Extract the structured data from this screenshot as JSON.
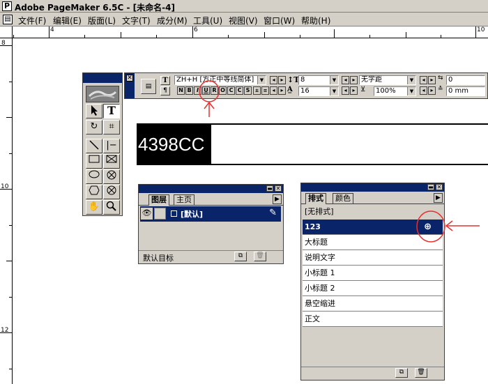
{
  "window": {
    "title": "Adobe PageMaker 6.5C - [未命名-4]"
  },
  "menubar": {
    "items": [
      "文件(F)",
      "编辑(E)",
      "版面(L)",
      "文字(T)",
      "成分(M)",
      "工具(U)",
      "视图(V)",
      "窗口(W)",
      "帮助(H)"
    ]
  },
  "ruler": {
    "top_labels": [
      "4",
      "6",
      "10"
    ],
    "left_labels": [
      "8",
      "10",
      "12"
    ]
  },
  "control_palette": {
    "font": "ZH+H  [方正中等线简体]",
    "size": "8",
    "leading": "16",
    "tracking": "无字距",
    "scale": "100%",
    "kerning": "0",
    "baseline": "0 mm",
    "style_buttons": [
      "N",
      "B",
      "I",
      "U",
      "R",
      "O",
      "C",
      "C",
      "S"
    ]
  },
  "document": {
    "selected_text": "4398CC"
  },
  "layers_palette": {
    "tabs": [
      "图层",
      "主页"
    ],
    "layer_name": "[默认]",
    "footer_label": "默认目标"
  },
  "styles_palette": {
    "tabs": [
      "排式",
      "颜色"
    ],
    "items": [
      "[无排式]",
      "123",
      "大标题",
      "说明文字",
      "小标题 1",
      "小标题 2",
      "悬空缩进",
      "正文"
    ],
    "selected_index": 1
  },
  "colors": {
    "titlebar": "#0a246a",
    "chrome": "#d4d0c8",
    "annotation": "#e83030"
  }
}
